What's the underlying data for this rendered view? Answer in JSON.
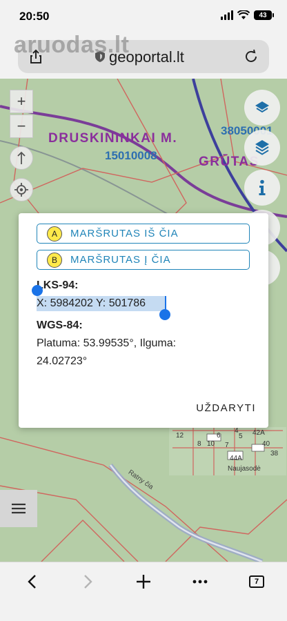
{
  "status_bar": {
    "time": "20:50",
    "battery": "43"
  },
  "watermark": {
    "text": "aruodas.lt"
  },
  "browser": {
    "url": "geoportal.lt"
  },
  "map": {
    "place_name": "DRUSKININKAI M.",
    "place_code": "15010008",
    "place_name_2": "GRŪTAS",
    "place_code_2": "38050001",
    "village": "Naujasodė",
    "river": "Ratny čia",
    "plots": [
      "12",
      "8",
      "6",
      "4",
      "42A",
      "10",
      "7",
      "40",
      "38",
      "44A",
      "5"
    ]
  },
  "map_controls": {
    "zoom_in": "+",
    "zoom_out": "−"
  },
  "modal": {
    "route_from": {
      "letter": "A",
      "label": "MARŠRUTAS IŠ ČIA"
    },
    "route_to": {
      "letter": "B",
      "label": "MARŠRUTAS Į ČIA"
    },
    "lks_heading": "LKS-94:",
    "lks_value": "X: 5984202 Y: 501786",
    "wgs_heading": "WGS-84:",
    "wgs_line_1": "Platuma: 53.99535°, Ilguma:",
    "wgs_line_2": "24.02723°",
    "close_label": "UŽDARYTI"
  },
  "toolbar": {
    "tab_count": "7"
  },
  "colors": {
    "accent": "#1f84b8",
    "map_green": "#b5cda7",
    "label_purple": "#8a2e9c",
    "code_blue": "#2e6fb0",
    "selection": "#c5dbf2"
  }
}
